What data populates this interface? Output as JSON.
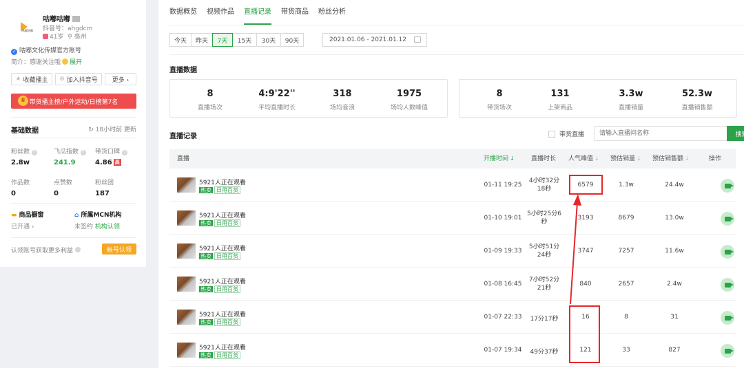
{
  "profile": {
    "logo_text": "咕嘟咕嘟",
    "name": "咕嘟咕嘟",
    "douyin_id": "抖音号：ahgdcm",
    "age": "41岁",
    "location": "⚲ 亳州",
    "verified": "咕嘟文化传媒官方账号",
    "intro_prefix": "简介：感谢关注哦",
    "intro_expand": "展开",
    "btn_favorite": "收藏播主",
    "btn_add": "加入抖音号",
    "btn_more": "更多 ›",
    "banner": "带货播主榜/户外运动/日榜第7名"
  },
  "basic": {
    "title": "基础数据",
    "updated": "18小时前  更新",
    "stats": [
      {
        "label": "粉丝数",
        "value": "2.8w"
      },
      {
        "label": "飞瓜指数",
        "value": "241.9"
      },
      {
        "label": "带货口碑",
        "value": "4.86",
        "tag": "高"
      },
      {
        "label": "作品数",
        "value": "0"
      },
      {
        "label": "点赞数",
        "value": "0"
      },
      {
        "label": "粉丝团",
        "value": "187"
      }
    ],
    "shop_title": "商品橱窗",
    "shop_status": "已开通 ›",
    "mcn_title": "所属MCN机构",
    "mcn_status": "未签约",
    "mcn_link": "机构认领",
    "claim_text": "认领账号获取更多利益",
    "claim_btn": "帐号认领"
  },
  "tabs": [
    "数据概览",
    "视频作品",
    "直播记录",
    "带货商品",
    "粉丝分析"
  ],
  "active_tab": 2,
  "ranges": [
    "今天",
    "昨天",
    "7天",
    "15天",
    "30天",
    "90天"
  ],
  "active_range": 2,
  "date_range": "2021.01.06 - 2021.01.12",
  "live_data": {
    "title": "直播数据",
    "left": [
      {
        "value": "8",
        "label": "直播场次"
      },
      {
        "value": "4:9'22''",
        "label": "平均直播时长"
      },
      {
        "value": "318",
        "label": "场均音浪"
      },
      {
        "value": "1975",
        "label": "场均人数峰值"
      }
    ],
    "right": [
      {
        "value": "8",
        "label": "带货场次"
      },
      {
        "value": "131",
        "label": "上架商品"
      },
      {
        "value": "3.3w",
        "label": "直播销量"
      },
      {
        "value": "52.3w",
        "label": "直播销售额"
      }
    ]
  },
  "records": {
    "title": "直播记录",
    "filter_label": "带货直播",
    "search_placeholder": "请输入直播间名称",
    "search_btn": "搜索",
    "columns": [
      "直播",
      "开播时间",
      "直播时长",
      "人气峰值",
      "预估销量",
      "预估销售额",
      "操作"
    ],
    "rows": [
      {
        "title": "5921人正在观看",
        "hot": "热卖",
        "cat": "日用百货",
        "start": "01-11 19:25",
        "dur1": "4小时32分",
        "dur2": "18秒",
        "peak": "6579",
        "sales": "1.3w",
        "revenue": "24.4w"
      },
      {
        "title": "5921人正在观看",
        "hot": "热卖",
        "cat": "日用百货",
        "start": "01-10 19:01",
        "dur1": "5小时25分6",
        "dur2": "秒",
        "peak": "3193",
        "sales": "8679",
        "revenue": "13.0w"
      },
      {
        "title": "5921人正在观看",
        "hot": "热卖",
        "cat": "日用百货",
        "start": "01-09 19:33",
        "dur1": "5小时51分",
        "dur2": "24秒",
        "peak": "3747",
        "sales": "7257",
        "revenue": "11.6w"
      },
      {
        "title": "5921人正在观看",
        "hot": "热卖",
        "cat": "日用百货",
        "start": "01-08 16:45",
        "dur1": "7小时52分",
        "dur2": "21秒",
        "peak": "840",
        "sales": "2657",
        "revenue": "2.4w"
      },
      {
        "title": "5921人正在观看",
        "hot": "热卖",
        "cat": "日用百货",
        "start": "01-07 22:33",
        "dur1": "17分17秒",
        "dur2": "",
        "peak": "16",
        "sales": "8",
        "revenue": "31"
      },
      {
        "title": "5921人正在观看",
        "hot": "热卖",
        "cat": "日用百货",
        "start": "01-07 19:34",
        "dur1": "49分37秒",
        "dur2": "",
        "peak": "121",
        "sales": "33",
        "revenue": "827"
      }
    ]
  },
  "colors": {
    "accent": "#2ca34a",
    "highlight": "#e8262a",
    "banner": "#ee4d4d"
  }
}
